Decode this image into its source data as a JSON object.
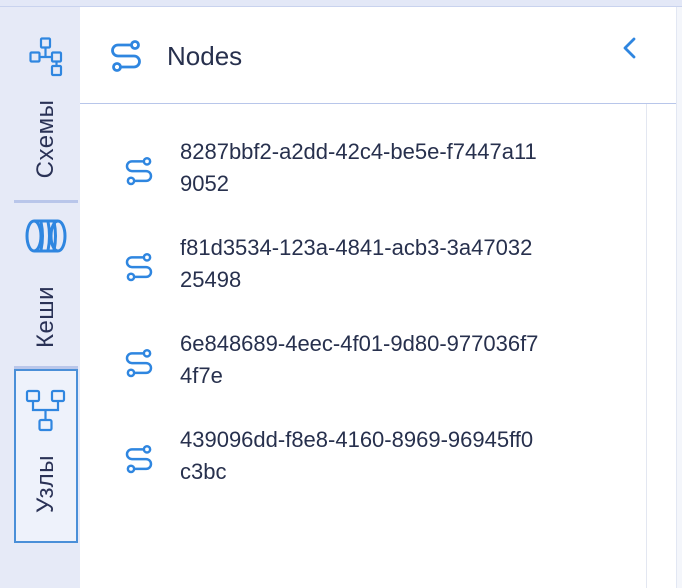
{
  "sidebar": {
    "tabs": [
      {
        "label": "Схемы",
        "icon": "schema-tree-icon",
        "active": false
      },
      {
        "label": "Кеши",
        "icon": "cache-cylinder-icon",
        "active": false
      },
      {
        "label": "Узлы",
        "icon": "nodes-graph-icon",
        "active": true
      }
    ]
  },
  "panel": {
    "title": "Nodes",
    "title_icon": "node-link-icon",
    "collapse_icon": "chevron-left-icon"
  },
  "nodes": [
    {
      "id": "8287bbf2-a2dd-42c4-be5e-f7447a119052"
    },
    {
      "id": "f81d3534-123a-4841-acb3-3a4703225498"
    },
    {
      "id": "6e848689-4eec-4f01-9d80-977036f74f7e"
    },
    {
      "id": "439096dd-f8e8-4160-8969-96945ff0c3bc"
    }
  ],
  "colors": {
    "accent": "#2f86e0",
    "text": "#27304d",
    "rail_bg": "#e6eaf7",
    "active_border": "#4a8fd8"
  }
}
